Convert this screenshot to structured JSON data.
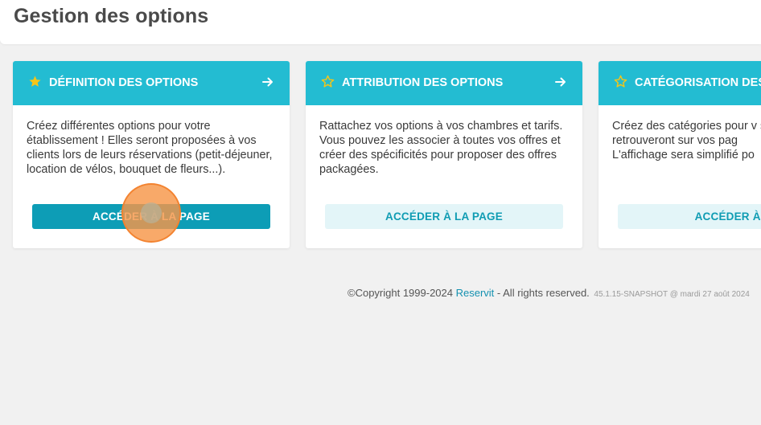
{
  "page": {
    "title": "Gestion des options"
  },
  "cards": [
    {
      "title": "DÉFINITION DES OPTIONS",
      "description": "Créez différentes options pour votre établissement ! Elles seront proposées à vos clients lors de leurs réservations (petit-déjeuner, location de vélos, bouquet de fleurs...).",
      "button": "ACCÉDER À LA PAGE",
      "icon": "star-icon",
      "arrow_icon": "arrow-right-icon"
    },
    {
      "title": "ATTRIBUTION DES OPTIONS",
      "description": "Rattachez vos options à vos chambres et tarifs. Vous pouvez les associer à toutes vos offres et créer des spécificités pour proposer des offres packagées.",
      "button": "ACCÉDER À LA PAGE",
      "icon": "star-outline-icon",
      "arrow_icon": "arrow-right-icon"
    },
    {
      "title": "CATÉGORISATION DES",
      "description": "Créez des catégories pour v se retrouveront sur vos pag L'affichage sera simplifié po",
      "button": "ACCÉDER À LA",
      "icon": "star-outline-icon"
    }
  ],
  "footer": {
    "copyright": "©Copyright 1999-2024 ",
    "link": "Reservit",
    "rights": " - All rights reserved.",
    "version": "45.1.15-SNAPSHOT @ mardi 27 août 2024"
  },
  "colors": {
    "header_bg": "#23bcd2",
    "primary_button": "#0d9db6",
    "light_button": "#e3f5f8",
    "star_filled": "#f5c518",
    "click_marker": "#f6964a"
  }
}
